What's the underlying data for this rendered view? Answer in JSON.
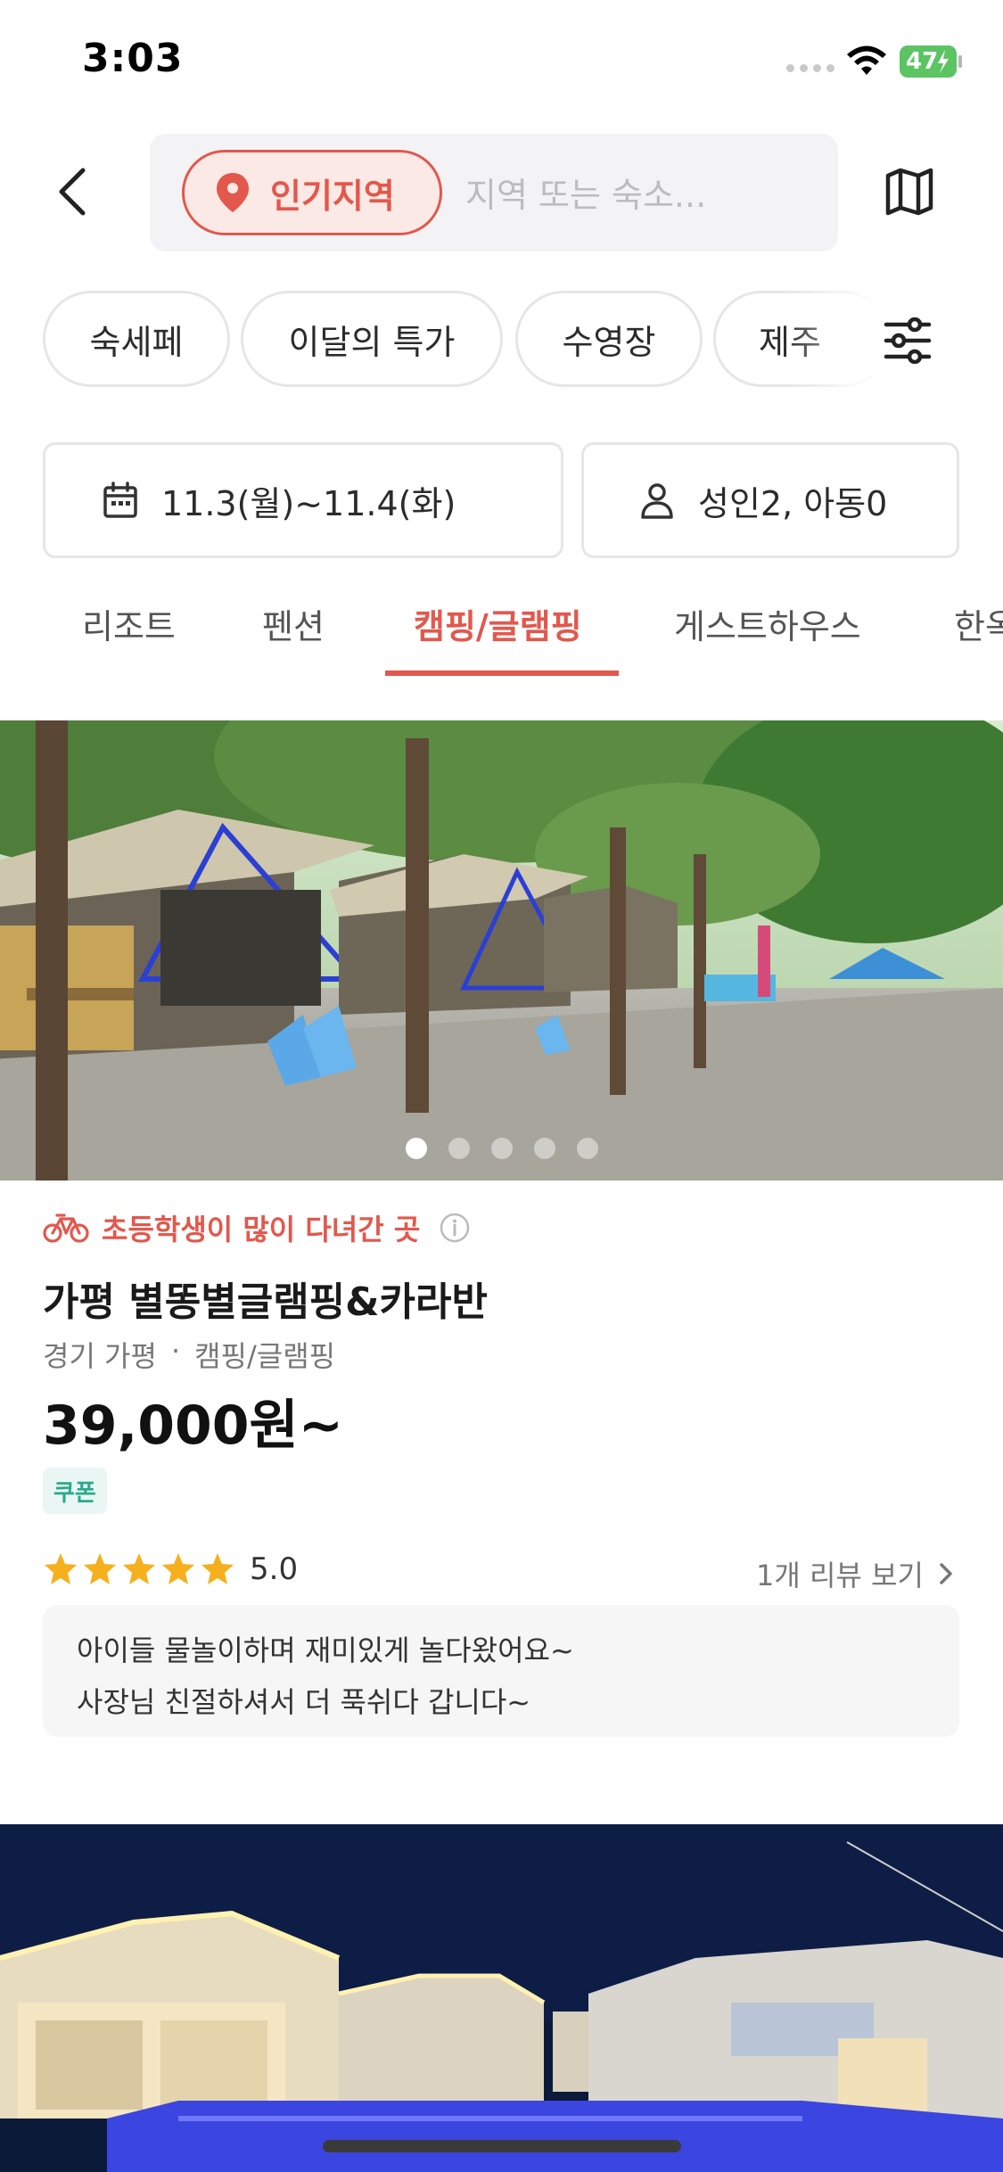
{
  "status_bar": {
    "time": "3:03",
    "battery": "47"
  },
  "header": {
    "region_chip": "인기지역",
    "search_placeholder": "지역 또는 숙소..."
  },
  "filters": {
    "chips": [
      "숙세페",
      "이달의 특가",
      "수영장",
      "제주"
    ]
  },
  "search_conditions": {
    "dates": "11.3(월)~11.4(화)",
    "guests": "성인2, 아동0"
  },
  "category_tabs": {
    "items": [
      "리조트",
      "펜션",
      "캠핑/글램핑",
      "게스트하우스",
      "한옥"
    ],
    "selected": "캠핑/글램핑"
  },
  "listing": {
    "badge": "초등학생이 많이 다녀간 곳",
    "name": "가평 별똥별글램핑&카라반",
    "region": "경기 가평",
    "category": "캠핑/글램핑",
    "price": "39,000원~",
    "coupon": "쿠폰",
    "rating": "5.0",
    "stars": 5,
    "review_link": "1개 리뷰 보기",
    "review_lines": [
      "아이들 물놀이하며 재미있게 놀다왔어요~",
      "사장님 친절하셔서 더 푹쉬다 갑니다~"
    ],
    "photo_count": 5,
    "photo_index": 1
  },
  "colors": {
    "accent": "#e2584d",
    "coupon": "#2aa98b",
    "star": "#f6b01e"
  }
}
